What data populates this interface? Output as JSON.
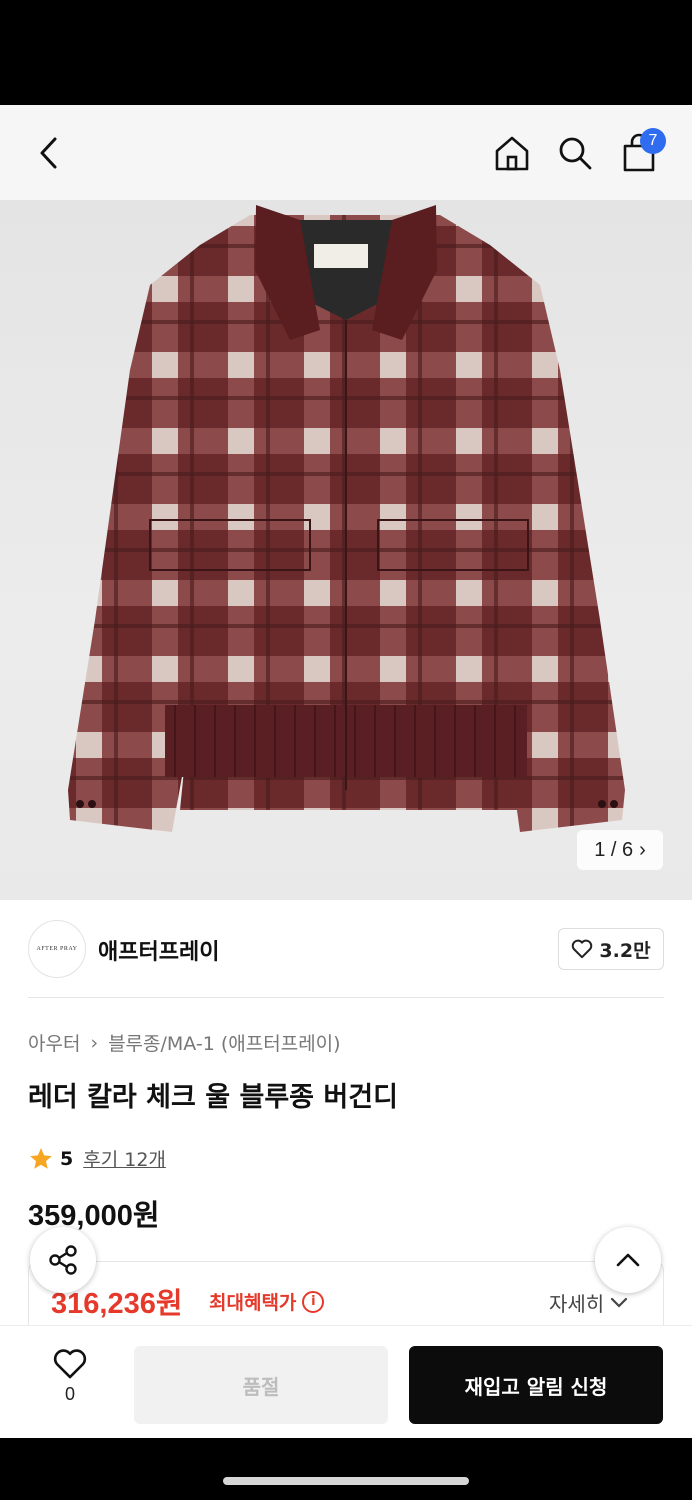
{
  "header": {
    "cart_count": "7"
  },
  "gallery": {
    "counter": "1 / 6",
    "label_text": "AFTER PRAY"
  },
  "brand": {
    "logo_text": "AFTER PRAY",
    "name": "애프터프레이",
    "likes": "3.2만"
  },
  "breadcrumb": {
    "category": "아우터",
    "subcategory": "블루종/MA-1 (애프터프레이)"
  },
  "product": {
    "title": "레더 칼라 체크 울 블루종 버건디",
    "rating": "5",
    "review_label": "후기 12개",
    "price": "359,000원"
  },
  "benefit": {
    "price": "316,236원",
    "label": "최대혜택가",
    "detail_label": "자세히"
  },
  "bottom_bar": {
    "wish_count": "0",
    "soldout_label": "품절",
    "restock_label": "재입고 알림 신청"
  },
  "colors": {
    "accent_red": "#e53a2b",
    "badge_blue": "#2f6cf0",
    "jacket_burgundy": "#5a1f22"
  },
  "icons": [
    "back-icon",
    "home-icon",
    "search-icon",
    "cart-icon",
    "heart-icon",
    "star-icon",
    "info-icon",
    "chevron-down-icon",
    "share-icon",
    "chevron-up-icon"
  ]
}
